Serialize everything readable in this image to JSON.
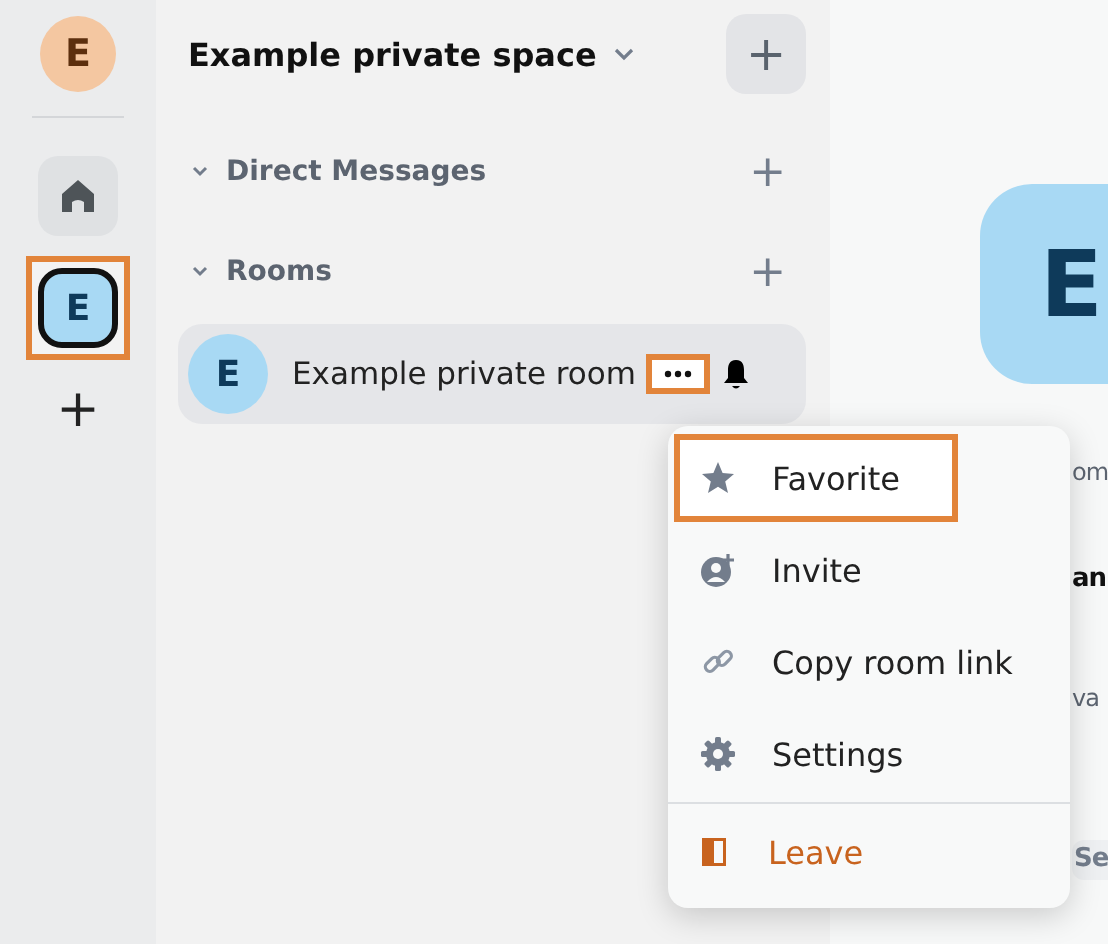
{
  "rail": {
    "user_initial": "E",
    "spaces": [
      {
        "kind": "home",
        "selected": false,
        "highlighted": false
      },
      {
        "kind": "space",
        "initial": "E",
        "selected": true,
        "highlighted": true
      }
    ],
    "add_label": "+"
  },
  "sidebar": {
    "title": "Example private space",
    "add_label": "+",
    "sections": [
      {
        "label": "Direct Messages",
        "expanded": true,
        "add_label": "+"
      },
      {
        "label": "Rooms",
        "expanded": true,
        "add_label": "+"
      }
    ],
    "rooms": [
      {
        "initial": "E",
        "name": "Example private room",
        "selected": true,
        "options_highlighted": true
      }
    ]
  },
  "main": {
    "avatar_initial": "E",
    "fragments": [
      {
        "kind": "text",
        "text": "om"
      },
      {
        "kind": "heading",
        "text": "an"
      },
      {
        "kind": "text",
        "text": "va"
      },
      {
        "kind": "button",
        "text": "Se"
      }
    ]
  },
  "menu": {
    "items": [
      {
        "kind": "favorite",
        "label": "Favorite",
        "highlighted": true,
        "danger": false
      },
      {
        "kind": "invite",
        "label": "Invite",
        "highlighted": false,
        "danger": false
      },
      {
        "kind": "link",
        "label": "Copy room link",
        "highlighted": false,
        "danger": false
      },
      {
        "kind": "settings",
        "label": "Settings",
        "highlighted": false,
        "danger": false
      },
      {
        "kind": "leave",
        "label": "Leave",
        "highlighted": false,
        "danger": true
      }
    ]
  }
}
